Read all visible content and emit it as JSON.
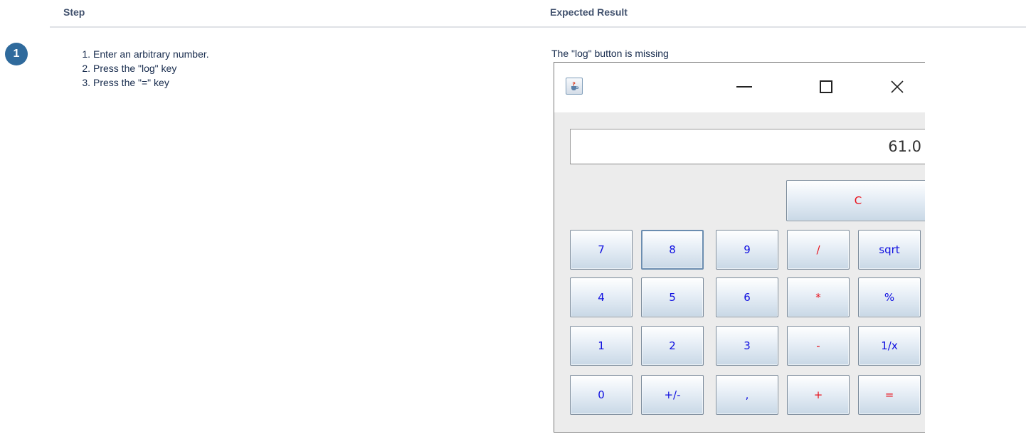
{
  "table": {
    "headers": {
      "step": "Step",
      "expected": "Expected Result"
    }
  },
  "test_step": {
    "number": "1",
    "instructions": [
      {
        "num": "1.",
        "text": "Enter an arbitrary number."
      },
      {
        "num": "2.",
        "text": "Press the \"log\" key"
      },
      {
        "num": "3.",
        "text": "Press the \"=\" key"
      }
    ],
    "expected_result": "The \"log\" button is missing"
  },
  "calculator": {
    "app_icon": "java-cup-icon",
    "window_controls": [
      "minimize-icon",
      "maximize-icon",
      "close-icon"
    ],
    "display_value": "61.0",
    "colors": {
      "operator": "#e8121c",
      "digit": "#1010e0",
      "clear": "#e8121c"
    },
    "clear_key": "C",
    "keys": [
      {
        "label": "7",
        "kind": "digit"
      },
      {
        "label": "8",
        "kind": "digit"
      },
      {
        "label": "9",
        "kind": "digit"
      },
      {
        "label": "/",
        "kind": "operator"
      },
      {
        "label": "sqrt",
        "kind": "digit"
      },
      {
        "label": "4",
        "kind": "digit"
      },
      {
        "label": "5",
        "kind": "digit"
      },
      {
        "label": "6",
        "kind": "digit"
      },
      {
        "label": "*",
        "kind": "operator"
      },
      {
        "label": "%",
        "kind": "digit"
      },
      {
        "label": "1",
        "kind": "digit"
      },
      {
        "label": "2",
        "kind": "digit"
      },
      {
        "label": "3",
        "kind": "digit"
      },
      {
        "label": "-",
        "kind": "operator"
      },
      {
        "label": "1/x",
        "kind": "digit"
      },
      {
        "label": "0",
        "kind": "digit"
      },
      {
        "label": "+/-",
        "kind": "digit"
      },
      {
        "label": ",",
        "kind": "digit"
      },
      {
        "label": "+",
        "kind": "operator"
      },
      {
        "label": "=",
        "kind": "operator"
      }
    ],
    "focused_key": "8"
  }
}
